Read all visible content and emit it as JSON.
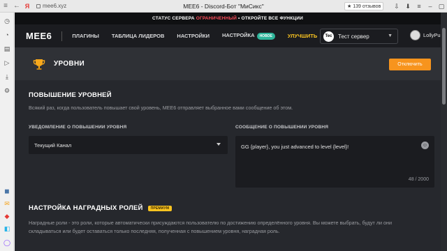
{
  "browser": {
    "url": "mee6.xyz",
    "title": "MEE6 - Discord-Бот \"МиСикс\"",
    "reviews": "139 отзывов"
  },
  "notice": {
    "prefix": "СТАТУС СЕРВЕРА",
    "status": "ОГРАНИЧЕННЫЙ",
    "suffix": "• ОТКРОЙТЕ ВСЕ ФУНКЦИИ"
  },
  "nav": {
    "logo": "MEE6",
    "plugins": "ПЛАГИНЫ",
    "leaderboard": "ТАБЛИЦА ЛИДЕРОВ",
    "settings": "НАСТРОЙКИ",
    "settings2": "НАСТРОЙКА",
    "new_badge": "НОВОЕ",
    "upgrade": "УЛУЧШИТЬ",
    "server_icon": "Tec",
    "server_name": "Тест сервер",
    "username": "LollyPu"
  },
  "header": {
    "title": "УРОВНИ",
    "disable_button": "Отключить"
  },
  "levelup": {
    "title": "ПОВЫШЕНИЕ УРОВНЕЙ",
    "description": "Всякий раз, когда пользователь повышает свой уровень, MEE6 отправляет выбранное вами сообщение об этом.",
    "notify_label": "УВЕДОМЛЕНИЕ О ПОВЫШЕНИИ УРОВНЯ",
    "notify_value": "Текущий Канал",
    "message_label": "СООБЩЕНИЕ О ПОВЫШЕНИИ УРОВНЯ",
    "message_value": "GG {player}, you just advanced to level {level}!",
    "counter": "48 / 2000"
  },
  "rewards": {
    "title": "НАСТРОЙКА НАГРАДНЫХ РОЛЕЙ",
    "premium_badge": "ПРЕМИУМ",
    "description": "Наградные роли - это роли, которые автоматически присуждаются пользователю по достижению определённого уровня. Вы можете выбрать, будут ли они складываться или будет оставаться только последняя, полученная с повышением уровня, наградная роль."
  },
  "colors": {
    "accent_orange": "#f7941d",
    "upgrade_yellow": "#f9c320",
    "new_badge_green": "#2fb59b",
    "warning_red": "#ff4d5a"
  }
}
